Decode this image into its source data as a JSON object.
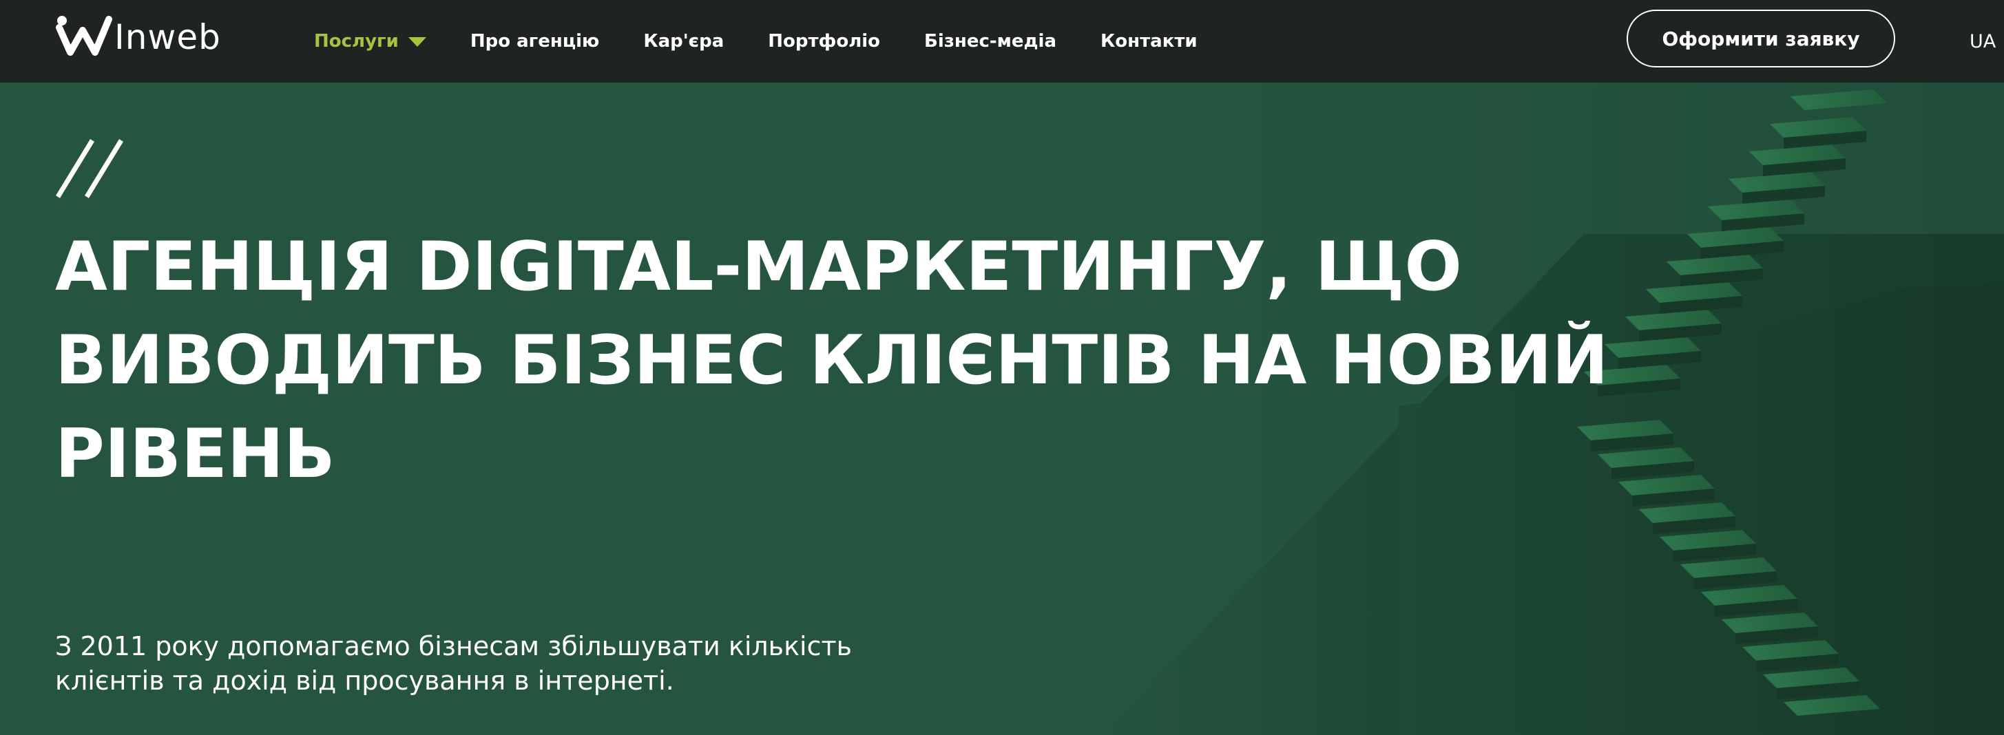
{
  "brand": {
    "logo_text": "Inweb",
    "accent_color": "#a9c23f",
    "header_bg": "#1f2321",
    "hero_bg": "#25553f"
  },
  "nav": {
    "items": [
      {
        "label": "Послуги",
        "active": true,
        "has_dropdown": true
      },
      {
        "label": "Про агенцію"
      },
      {
        "label": "Кар'єра"
      },
      {
        "label": "Портфоліо"
      },
      {
        "label": "Бізнес-медіа"
      },
      {
        "label": "Контакти"
      }
    ]
  },
  "header": {
    "cta_label": "Оформити заявку",
    "language": "UA"
  },
  "hero": {
    "title_line1": "АГЕНЦІЯ DIGITAL-МАРКЕТИНГУ, ЩО",
    "title_line2": "ВИВОДИТЬ БІЗНЕС КЛІЄНТІВ НА НОВИЙ",
    "title_line3": "РІВЕНЬ",
    "subtitle_line1": "З 2011 року допомагаємо бізнесам збільшувати кількість",
    "subtitle_line2": "клієнтів та дохід від просування в інтернеті."
  }
}
